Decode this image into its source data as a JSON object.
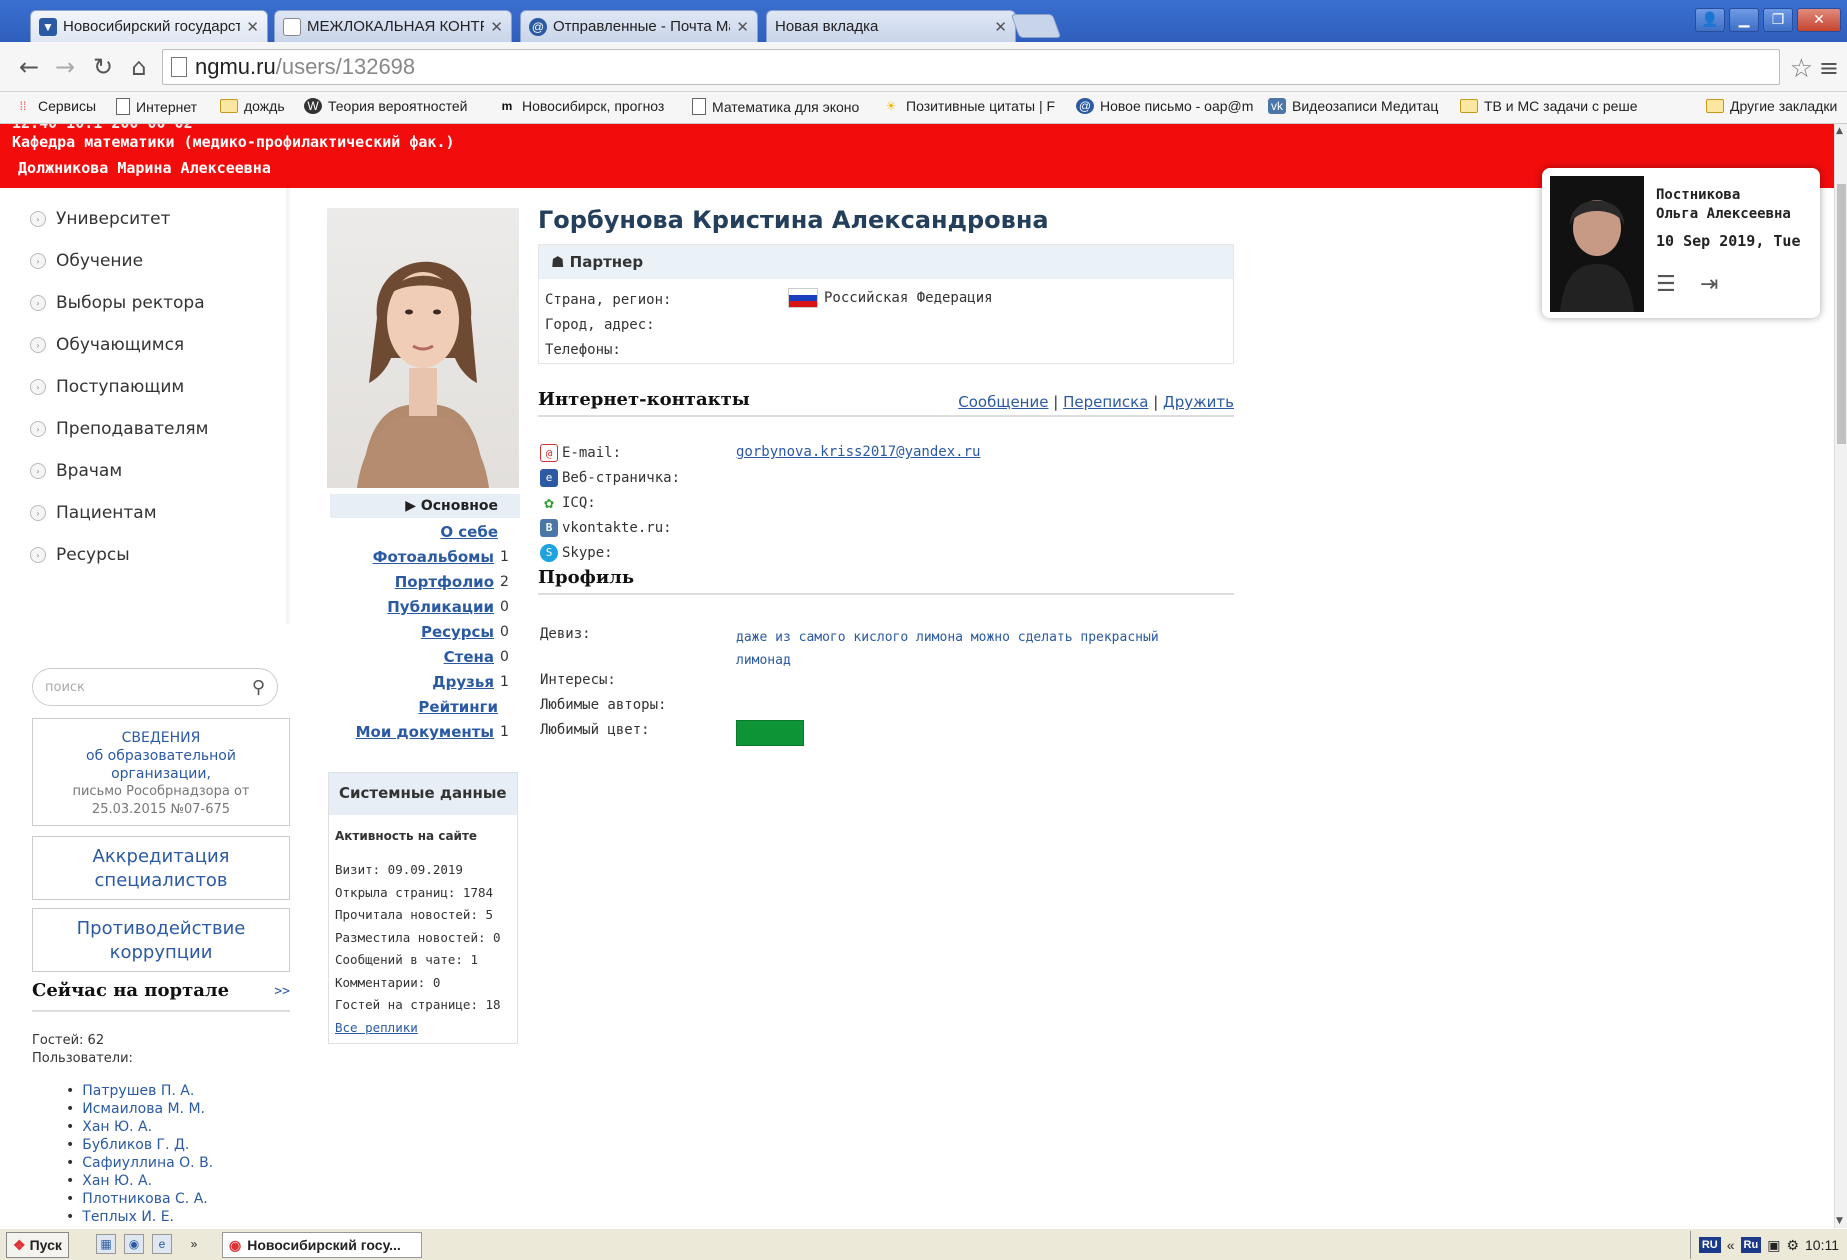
{
  "browser": {
    "tabs": [
      {
        "title": "Новосибирский государств",
        "icon_color": "#2b5aa3"
      },
      {
        "title": "МЕЖЛОКАЛЬНАЯ КОНТРАБ",
        "icon_color": "#888888"
      },
      {
        "title": "Отправленные - Почта Mail",
        "icon_color": "#2b5aa3"
      },
      {
        "title": "Новая вкладка",
        "icon_color": ""
      }
    ],
    "url_host": "ngmu.ru",
    "url_path": "/users/132698",
    "bookmarks": [
      {
        "label": "Сервисы",
        "icon": "apps-icon"
      },
      {
        "label": "Интернет",
        "icon": "page-icon"
      },
      {
        "label": "дождь",
        "icon": "folder-icon"
      },
      {
        "label": "Теория вероятностей",
        "icon": "wordpress-icon"
      },
      {
        "label": "Новосибирск, прогноз",
        "icon": "m-icon"
      },
      {
        "label": "Математика для эконо",
        "icon": "page-icon"
      },
      {
        "label": "Позитивные цитаты | F",
        "icon": "sun-icon"
      },
      {
        "label": "Новое письмо - oap@m",
        "icon": "mail-icon"
      },
      {
        "label": "Видеозаписи Медитац",
        "icon": "vk-icon"
      },
      {
        "label": "ТВ и МС задачи с реше",
        "icon": "folder-icon"
      },
      {
        "label": "Другие закладки",
        "icon": "folder-icon"
      }
    ]
  },
  "header": {
    "cut_line": "12:40 10:1 200 00 02",
    "department": "Кафедра математики (медико-профилактический фак.)",
    "user": "Должникова Марина Алексеевна",
    "bg_color": "#f20c0c"
  },
  "leftmenu": {
    "items": [
      "Университет",
      "Обучение",
      "Выборы ректора",
      "Обучающимся",
      "Поступающим",
      "Преподавателям",
      "Врачам",
      "Пациентам",
      "Ресурсы"
    ]
  },
  "search": {
    "placeholder": "поиск"
  },
  "infoboxes": {
    "svedeniya": {
      "line1": "СВЕДЕНИЯ",
      "line2": "об образовательной",
      "line3": "организации,",
      "line4": "письмо Рособрнадзора от",
      "line5": "25.03.2015 №07-675"
    },
    "accreditation": {
      "line1": "Аккредитация",
      "line2": "специалистов"
    },
    "corruption": {
      "line1": "Противодействие",
      "line2": "коррупции"
    }
  },
  "online": {
    "title": "Сейчас на портале",
    "more": ">>",
    "guests": "Гостей: 62",
    "users_label": "Пользователи:",
    "users": [
      "Патрушев П. А.",
      "Исмаилова М. М.",
      "Хан Ю. А.",
      "Бубликов Г. Д.",
      "Сафиуллина О. В.",
      "Хан Ю. А.",
      "Плотникова С. А.",
      "Теплых И. Е."
    ]
  },
  "subnav": {
    "active": "Основное",
    "items": [
      {
        "label": "О себе",
        "count": ""
      },
      {
        "label": "Фотоальбомы",
        "count": "1"
      },
      {
        "label": "Портфолио",
        "count": "2"
      },
      {
        "label": "Публикации",
        "count": "0"
      },
      {
        "label": "Ресурсы",
        "count": "0"
      },
      {
        "label": "Стена",
        "count": "0"
      },
      {
        "label": "Друзья",
        "count": "1"
      },
      {
        "label": "Рейтинги",
        "count": ""
      },
      {
        "label": "Мои документы",
        "count": "1"
      }
    ]
  },
  "system": {
    "title": "Системные данные",
    "subtitle": "Активность на сайте",
    "stats": [
      "Визит: 09.09.2019",
      "Открыла страниц: 1784",
      "Прочитала новостей: 5",
      "Разместила новостей: 0",
      "Сообщений в чате: 1",
      "Комментарии: 0",
      "Гостей на странице: 18"
    ],
    "all_replies": "Все реплики"
  },
  "profile": {
    "name": "Горбунова Кристина Александровна",
    "role": "Партнер",
    "country_label": "Страна, регион:",
    "country_value": "Российская Федерация",
    "city_label": "Город, адрес:",
    "phones_label": "Телефоны:",
    "contacts_title": "Интернет-контакты",
    "actions": {
      "message": "Сообщение",
      "sep": "|",
      "chat": "Переписка",
      "friend": "Дружить"
    },
    "contacts": [
      {
        "label": "E-mail:",
        "value": "gorbynova.kriss2017@yandex.ru"
      },
      {
        "label": "Веб-страничка:",
        "value": ""
      },
      {
        "label": "ICQ:",
        "value": ""
      },
      {
        "label": "vkontakte.ru:",
        "value": ""
      },
      {
        "label": "Skype:",
        "value": ""
      }
    ],
    "profile_title": "Профиль",
    "motto_label": "Девиз:",
    "motto_value": "даже из самого кислого лимона можно сделать прекрасный лимонад",
    "interests_label": "Интересы:",
    "authors_label": "Любимые авторы:",
    "color_label": "Любимый цвет:",
    "favorite_color": "#0d9436"
  },
  "usercard": {
    "name_line1": "Постникова",
    "name_line2": "Ольга Алексеевна",
    "date": "10 Sep 2019, Tue"
  },
  "taskbar": {
    "start": "Пуск",
    "task": "Новосибирский госу...",
    "lang1": "RU",
    "lang2": "Ru",
    "time": "10:11"
  }
}
